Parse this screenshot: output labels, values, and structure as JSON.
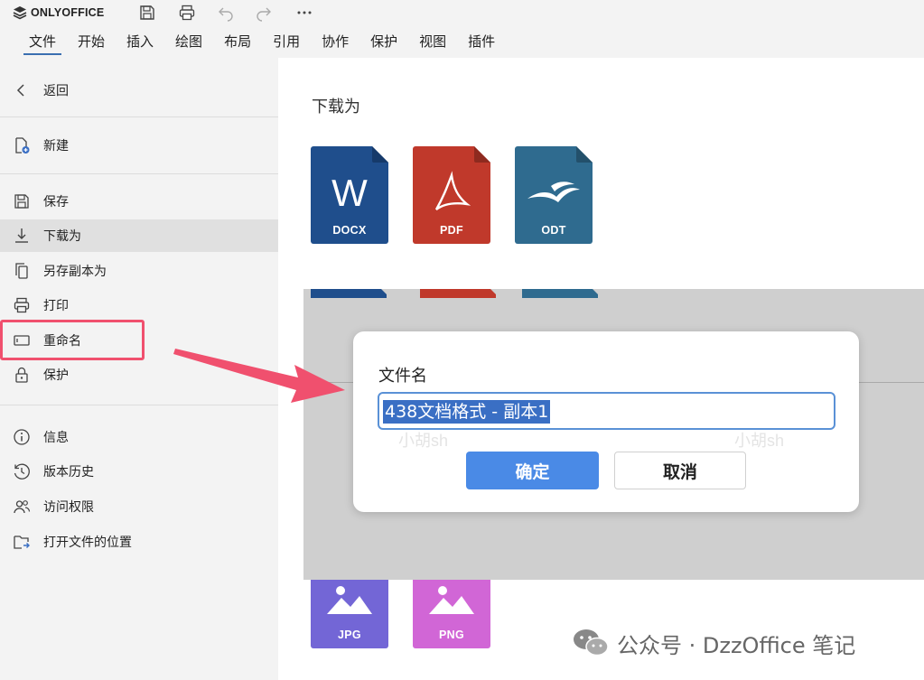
{
  "app": {
    "brand": "ONLYOFFICE"
  },
  "menu": {
    "tabs": [
      "文件",
      "开始",
      "插入",
      "绘图",
      "布局",
      "引用",
      "协作",
      "保护",
      "视图",
      "插件"
    ]
  },
  "sidebar": {
    "back": "返回",
    "items": [
      {
        "label": "新建",
        "icon": "new-document-icon"
      },
      {
        "label": "保存",
        "icon": "save-icon"
      },
      {
        "label": "下载为",
        "icon": "download-icon"
      },
      {
        "label": "另存副本为",
        "icon": "copy-icon"
      },
      {
        "label": "打印",
        "icon": "print-icon"
      },
      {
        "label": "重命名",
        "icon": "rename-icon"
      },
      {
        "label": "保护",
        "icon": "lock-icon"
      },
      {
        "label": "信息",
        "icon": "info-icon"
      },
      {
        "label": "版本历史",
        "icon": "history-icon"
      },
      {
        "label": "访问权限",
        "icon": "users-icon"
      },
      {
        "label": "打开文件的位置",
        "icon": "folder-open-icon"
      }
    ]
  },
  "main": {
    "title": "下载为",
    "formats": [
      {
        "label": "DOCX",
        "letter": "W",
        "color": "#1f4e8c"
      },
      {
        "label": "PDF",
        "color": "#c0392b"
      },
      {
        "label": "ODT",
        "color": "#2f6b8f"
      },
      {
        "label": "JPG",
        "color": "#7366d6"
      },
      {
        "label": "PNG",
        "color": "#d166d6"
      }
    ]
  },
  "dialog": {
    "label": "文件名",
    "value": "438文档格式 - 副本1",
    "watermark": "小胡sh",
    "ok": "确定",
    "cancel": "取消"
  },
  "footer": {
    "text": "公众号 · DzzOffice 笔记"
  },
  "colors": {
    "accent": "#4a8ae6",
    "highlight": "#f0506e"
  }
}
